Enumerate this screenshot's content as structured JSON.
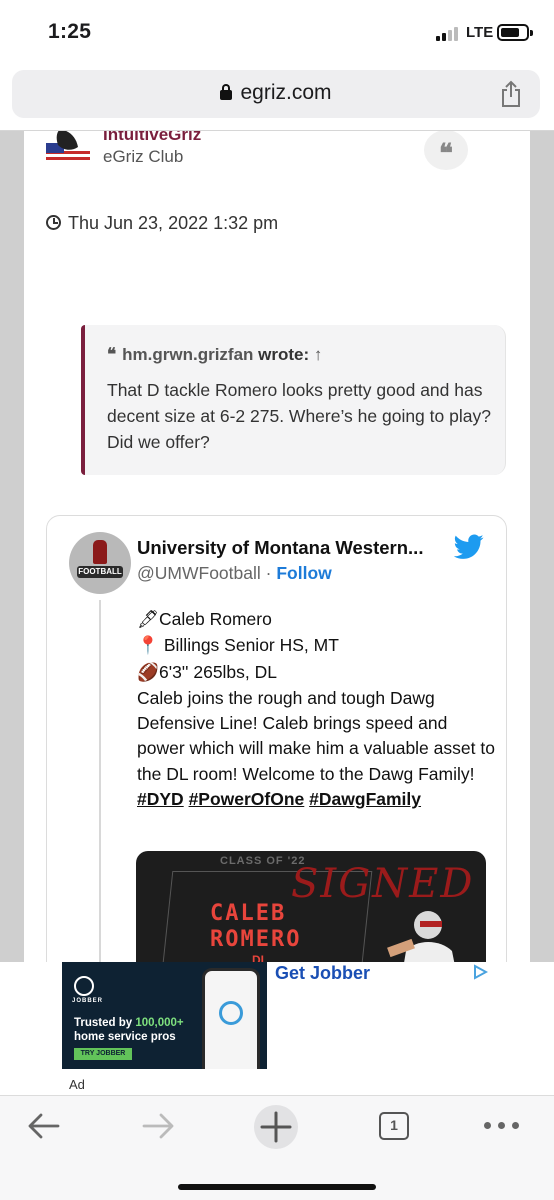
{
  "status_bar": {
    "time": "1:25",
    "network": "LTE",
    "battery_level": 0.75
  },
  "browser": {
    "url": "egriz.com"
  },
  "post": {
    "author": "IntuitiveGriz",
    "rank": "eGriz Club",
    "date": "Thu Jun 23, 2022 1:32 pm",
    "quote_button_glyph": "❝",
    "quote": {
      "author": "hm.grwn.grizfan",
      "wrote_label": "wrote:",
      "arrow": "↑",
      "text": "That D tackle Romero looks pretty good and has decent size at 6-2 275. Where’s he going to play? Did we offer?"
    },
    "tweet": {
      "display_name": "University of Montana Western...",
      "handle": "@UMWFootball",
      "separator": "·",
      "follow_label": "Follow",
      "avatar_text": "FOOTBALL",
      "lines": [
        {
          "emoji": "🖋",
          "text": "Caleb Romero"
        },
        {
          "emoji": "📍",
          "text": " Billings Senior HS, MT"
        },
        {
          "emoji": "🏈",
          "text": "6'3'' 265lbs, DL"
        }
      ],
      "body": "Caleb joins the rough and tough Dawg Defensive Line! Caleb brings speed and power which will make him a valuable asset to the DL room! Welcome to the Dawg Family!",
      "hashtags": [
        "#DYD",
        "#PowerOfOne",
        "#DawgFamily"
      ],
      "media": {
        "class_label": "CLASS OF '22",
        "signed_label": "SIGNED",
        "first_name": "CALEB",
        "last_name": "ROMERO",
        "position": "DL"
      }
    }
  },
  "ad": {
    "title": "Get Jobber",
    "label": "Ad",
    "brand": "JOBBER",
    "headline_prefix": "Trusted by ",
    "headline_highlight": "100,000+",
    "headline_suffix": " home service pros",
    "cta": "TRY JOBBER"
  },
  "toolbar": {
    "tab_count": "1"
  },
  "colors": {
    "accent": "#7a1f3d",
    "link": "#1d7bd8",
    "twitter": "#1d9bf0",
    "ad_title": "#1a4fb4"
  }
}
